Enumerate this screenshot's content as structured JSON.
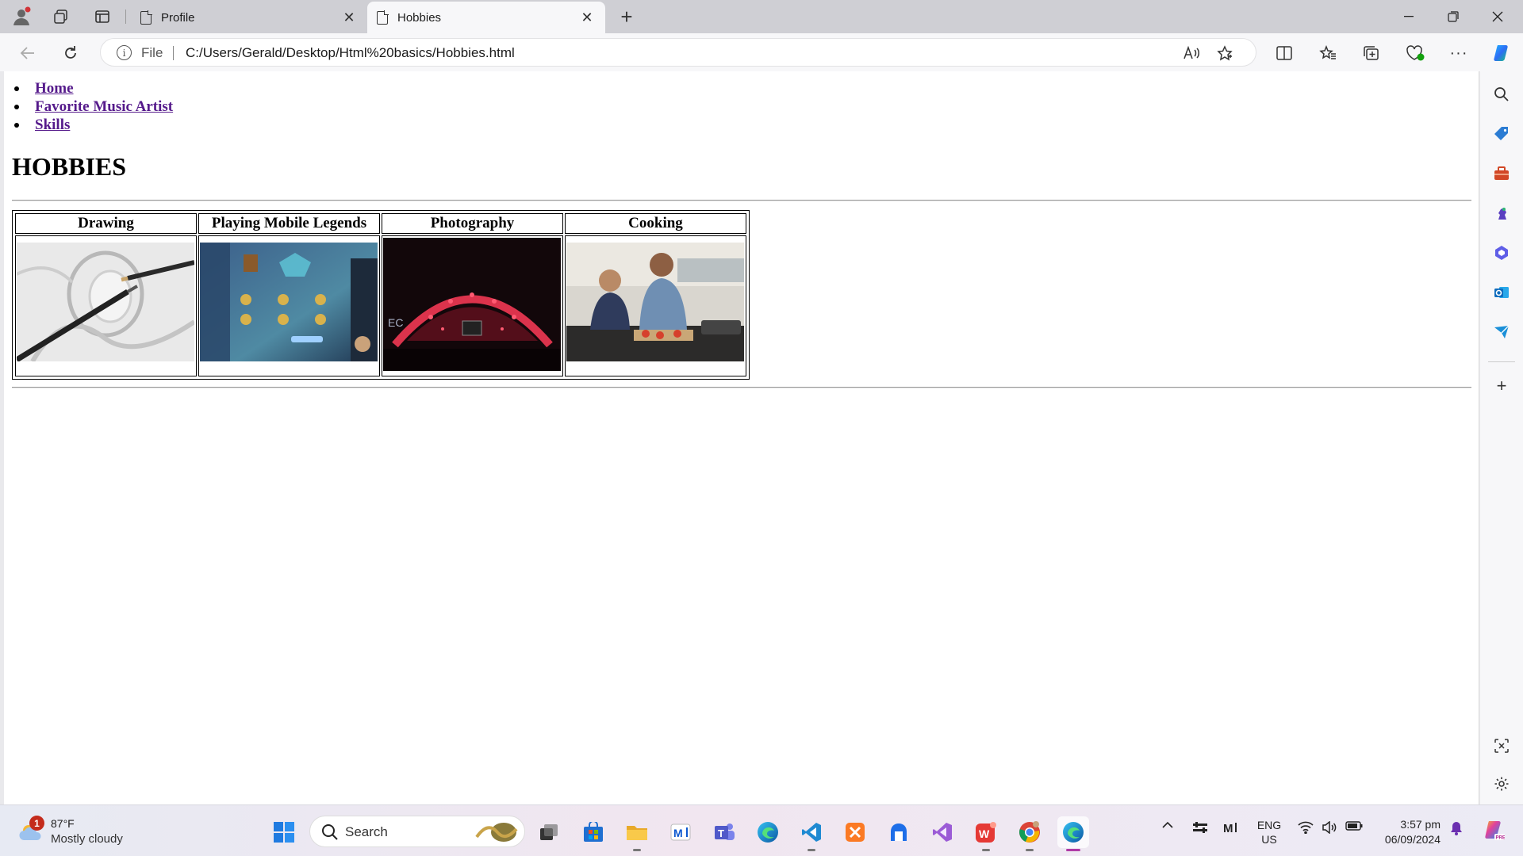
{
  "browser": {
    "tabs": [
      {
        "title": "Profile",
        "active": false
      },
      {
        "title": "Hobbies",
        "active": true
      }
    ],
    "address": {
      "scheme_label": "File",
      "url": "C:/Users/Gerald/Desktop/Html%20basics/Hobbies.html"
    }
  },
  "page": {
    "nav": [
      {
        "label": "Home"
      },
      {
        "label": "Favorite Music Artist"
      },
      {
        "label": "Skills"
      }
    ],
    "title": "HOBBIES",
    "table": {
      "headers": [
        "Drawing",
        "Playing Mobile Legends",
        "Photography",
        "Cooking"
      ]
    }
  },
  "taskbar": {
    "weather": {
      "badge": "1",
      "temp": "87°F",
      "desc": "Mostly cloudy"
    },
    "search_label": "Search",
    "lang": {
      "line1": "ENG",
      "line2": "US"
    },
    "clock": {
      "time": "3:57 pm",
      "date": "06/09/2024"
    }
  },
  "colors": {
    "link_visited": "#551a8b",
    "active_tab_bg": "#f7f7f9",
    "tabstrip_bg": "#cfcfd4",
    "edge_accent": "#0c59a4"
  }
}
